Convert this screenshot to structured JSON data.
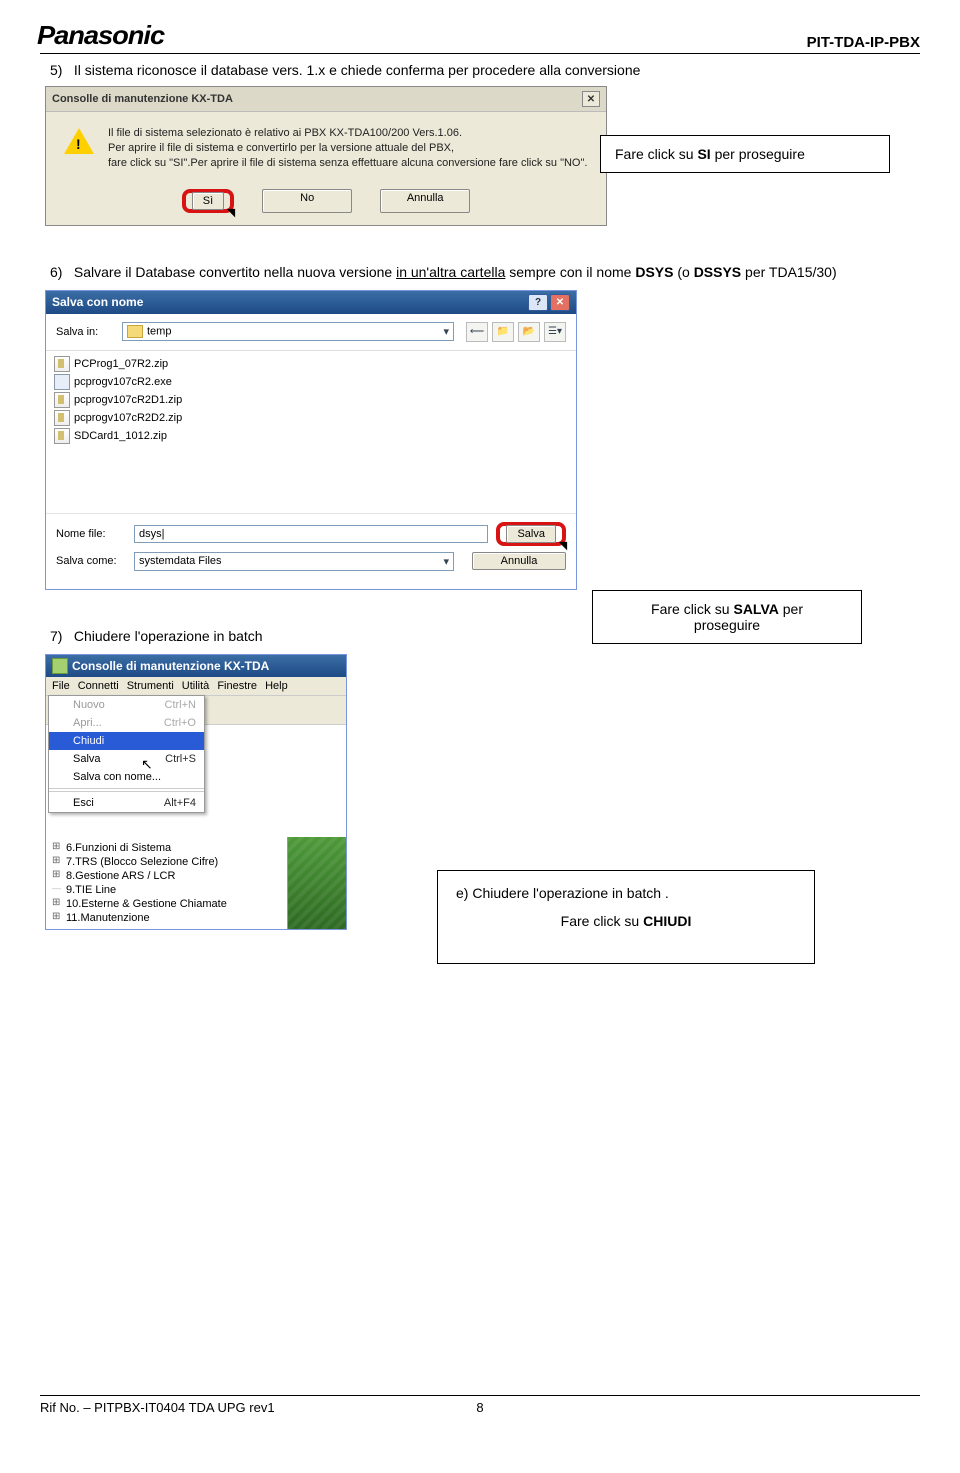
{
  "header": {
    "brand": "Panasonic",
    "right": "PIT-TDA-IP-PBX"
  },
  "step5": {
    "num": "5)",
    "text": "Il sistema riconosce il database vers. 1.x e chiede conferma per procedere alla conversione"
  },
  "dialog1": {
    "title": "Consolle di manutenzione KX-TDA",
    "line1": "Il file di sistema selezionato è relativo ai PBX KX-TDA100/200 Vers.1.06.",
    "line2": "Per aprire il file di sistema e convertirlo per la versione attuale del PBX,",
    "line3": "fare click su \"SI\".Per aprire il file di sistema senza effettuare alcuna conversione fare click su \"NO\".",
    "btn_si": "Sì",
    "btn_no": "No",
    "btn_annulla": "Annulla"
  },
  "note1": {
    "prefix": "Fare click su ",
    "bold": "SI",
    "suffix": "  per proseguire"
  },
  "step6": {
    "num": "6)",
    "text_prefix": "Salvare il Database convertito nella nuova versione ",
    "underline": "in un'altra cartella",
    "text_mid": " sempre con il nome ",
    "bold1": "DSYS",
    "text_paren_open": " (o ",
    "bold2": "DSSYS",
    "text_paren_close": " per TDA15/30)"
  },
  "save_dialog": {
    "title": "Salva con nome",
    "salva_in": "Salva in:",
    "folder": "temp",
    "files": [
      {
        "icon": "zip",
        "name": "PCProg1_07R2.zip"
      },
      {
        "icon": "exe",
        "name": "pcprogv107cR2.exe"
      },
      {
        "icon": "zip",
        "name": "pcprogv107cR2D1.zip"
      },
      {
        "icon": "zip",
        "name": "pcprogv107cR2D2.zip"
      },
      {
        "icon": "zip",
        "name": "SDCard1_1012.zip"
      }
    ],
    "nomefile_label": "Nome file:",
    "nomefile_value": "dsys",
    "salvacome_label": "Salva come:",
    "salvacome_value": "systemdata Files",
    "btn_salva": "Salva",
    "btn_annulla": "Annulla"
  },
  "note2": {
    "line1_prefix": "Fare click su ",
    "line1_bold": "SALVA",
    "line1_suffix": "  per",
    "line2": "proseguire"
  },
  "step7": {
    "num": "7)",
    "text": "Chiudere l'operazione in batch"
  },
  "maint": {
    "title": "Consolle di manutenzione KX-TDA",
    "menus": [
      "File",
      "Connetti",
      "Strumenti",
      "Utilità",
      "Finestre",
      "Help"
    ],
    "file_items": [
      {
        "label": "Nuovo",
        "accel": "Ctrl+N",
        "disabled": true
      },
      {
        "label": "Apri...",
        "accel": "Ctrl+O",
        "disabled": true
      },
      {
        "label": "Chiudi",
        "accel": "",
        "selected": true
      },
      {
        "label": "Salva",
        "accel": "Ctrl+S"
      },
      {
        "label": "Salva con nome...",
        "accel": ""
      },
      {
        "label": "Esci",
        "accel": "Alt+F4"
      }
    ],
    "tree": [
      {
        "label": "6.Funzioni di Sistema",
        "leaf": false
      },
      {
        "label": "7.TRS (Blocco Selezione Cifre)",
        "leaf": false
      },
      {
        "label": "8.Gestione ARS / LCR",
        "leaf": false
      },
      {
        "label": "9.TIE Line",
        "leaf": true
      },
      {
        "label": "10.Esterne & Gestione Chiamate",
        "leaf": false
      },
      {
        "label": "11.Manutenzione",
        "leaf": false
      }
    ]
  },
  "note3": {
    "line1_prefix": "e) ",
    "line1_text": "Chiudere l'operazione in batch .",
    "line2_prefix": "Fare click su ",
    "line2_bold": "CHIUDI"
  },
  "footer": {
    "left": "Rif No. – PITPBX-IT0404 TDA UPG rev1",
    "page": "8"
  }
}
